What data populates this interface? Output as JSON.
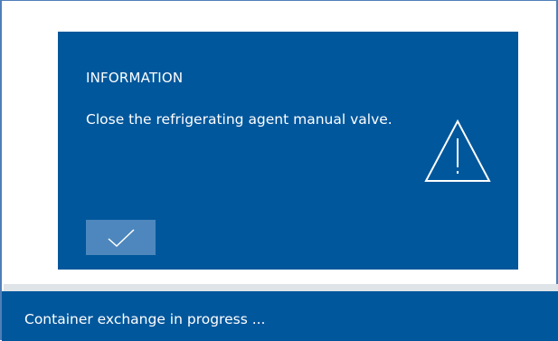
{
  "dialog": {
    "title": "INFORMATION",
    "message": "Close the refrigerating agent manual valve.",
    "icon": "warning-triangle-icon",
    "confirm_icon": "checkmark-icon"
  },
  "status_bar": {
    "text": "Container exchange in progress ..."
  },
  "colors": {
    "dialog_background": "#00579c",
    "confirm_button": "#4d87bd",
    "status_bar_background": "#00579c",
    "text": "#ffffff"
  }
}
